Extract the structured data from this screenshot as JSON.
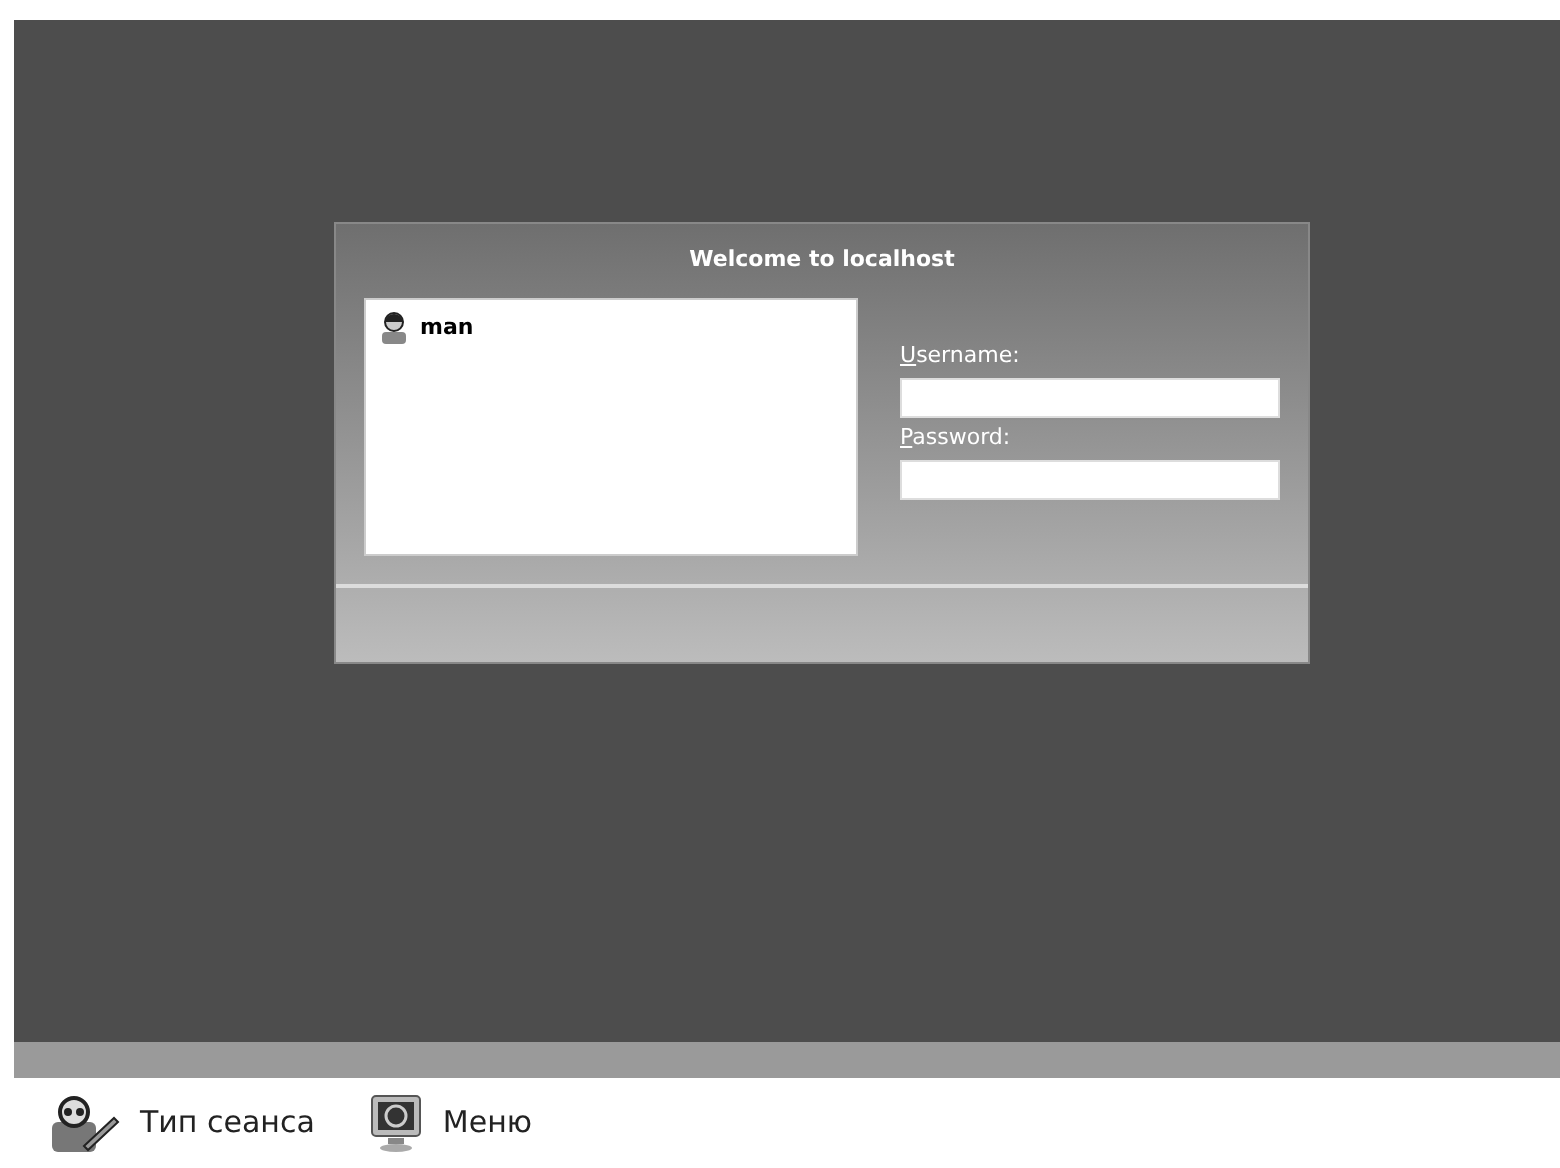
{
  "dialog": {
    "title": "Welcome to localhost",
    "users": [
      {
        "name": "man",
        "selected": false
      }
    ],
    "fields": [
      {
        "label": "Username:"
      },
      {
        "label": "Password:"
      }
    ]
  },
  "bottom_bar": {
    "items": [
      {
        "kind": "session",
        "label": "Тип сеанса"
      },
      {
        "kind": "menu",
        "label": "Меню"
      }
    ]
  }
}
